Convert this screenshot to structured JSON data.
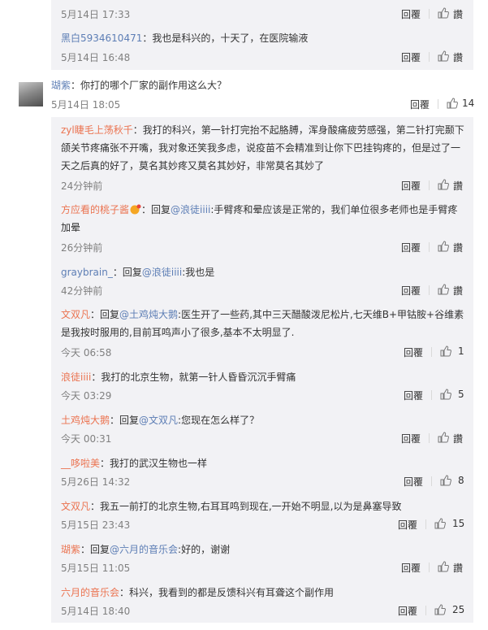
{
  "top_reply_partial": {
    "time": "5月14日 17:33",
    "reply_label": "回覆",
    "like_label": "讚"
  },
  "reply_hb": {
    "user": "黑白5934610471",
    "text": "：我也是科兴的，十天了，在医院输液",
    "time": "5月14日 16:48",
    "reply_label": "回覆",
    "like_label": "讚"
  },
  "main_comment": {
    "user": "瑚紫",
    "text": "：你打的哪个厂家的副作用这么大？",
    "time": "5月14日 18:05",
    "reply_label": "回覆",
    "like_count": "14"
  },
  "replies": [
    {
      "user": "zyl睫毛上荡秋千",
      "text": "：我打的科兴，第一针打完抬不起胳膊，浑身酸痛疲劳感强，第二针打完颞下颌关节疼痛张不开嘴，我对象还笑我多虑，说疫苗不会精准到让你下巴挂钩疼的，但是过了一天之后真的好了，莫名其妙疼又莫名其妙好，非常莫名其妙了",
      "time": "24分钟前",
      "reply_label": "回覆",
      "like_label": "讚"
    },
    {
      "user": "方应看的桃子酱",
      "prefix": "：回复",
      "mention": "@浪徒iiii",
      "text": ":手臂疼和晕应该是正常的，我们单位很多老师也是手臂疼加晕",
      "time": "26分钟前",
      "reply_label": "回覆",
      "like_label": "讚"
    },
    {
      "user": "graybrain_",
      "prefix": "：回复",
      "mention": "@浪徒iiii",
      "text": ":我也是",
      "time": "42分钟前",
      "reply_label": "回覆",
      "like_label": "讚"
    },
    {
      "user": "文双凡",
      "prefix": "：回复",
      "mention": "@土鸡炖大鹅",
      "text": ":医生开了一些药,其中三天醋酸泼尼松片,七天维B+甲钴胺+谷维素是我按时服用的,目前耳鸣声小了很多,基本不太明显了.",
      "time": "今天 06:58",
      "reply_label": "回覆",
      "like_count": "1"
    },
    {
      "user": "浪徒iiii",
      "text": "：我打的北京生物，就第一针人昏昏沉沉手臂痛",
      "time": "今天 03:29",
      "reply_label": "回覆",
      "like_count": "5"
    },
    {
      "user": "土鸡炖大鹅",
      "prefix": "：回复",
      "mention": "@文双凡",
      "text": ":您现在怎么样了？",
      "time": "今天 00:31",
      "reply_label": "回覆",
      "like_label": "讚"
    },
    {
      "user": "__哆啦美",
      "text": "：我打的武汉生物也一样",
      "time": "5月26日 14:32",
      "reply_label": "回覆",
      "like_count": "8"
    },
    {
      "user": "文双凡",
      "text": "：我五一前打的北京生物,右耳耳鸣到现在,一开始不明显,以为是鼻塞导致",
      "time": "5月15日 23:43",
      "reply_label": "回覆",
      "like_count": "15"
    },
    {
      "user": "瑚紫",
      "prefix": "：回复",
      "mention": "@六月的音乐会",
      "text": ":好的，谢谢",
      "time": "5月15日 11:05",
      "reply_label": "回覆",
      "like_label": "讚"
    },
    {
      "user": "六月的音乐会",
      "text": "：科兴，我看到的都是反馈科兴有耳聋这个副作用",
      "time": "5月14日 18:40",
      "reply_label": "回覆",
      "like_count": "25"
    }
  ]
}
